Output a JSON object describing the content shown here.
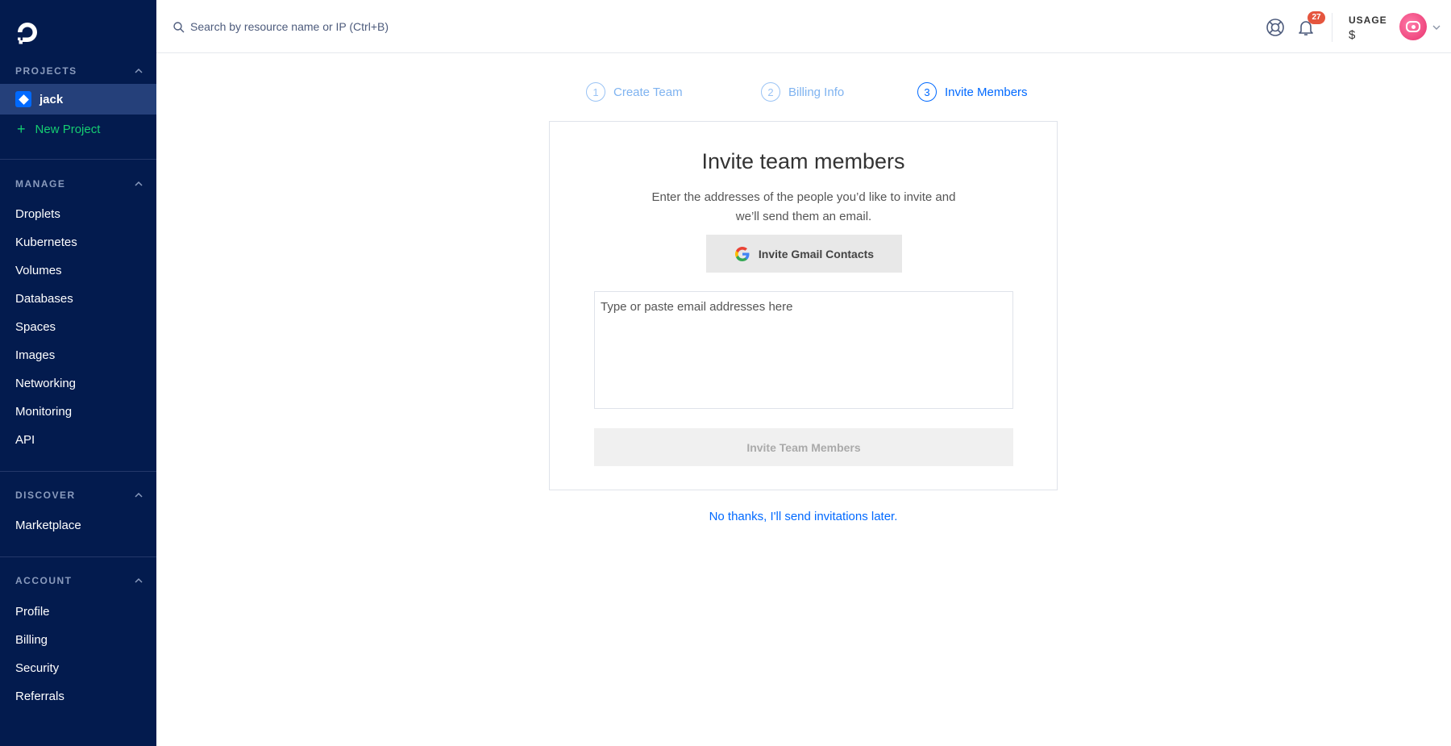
{
  "sidebar": {
    "projects_heading": "PROJECTS",
    "project": {
      "name": "jack"
    },
    "new_project": "New Project",
    "manage_heading": "MANAGE",
    "manage_items": [
      "Droplets",
      "Kubernetes",
      "Volumes",
      "Databases",
      "Spaces",
      "Images",
      "Networking",
      "Monitoring",
      "API"
    ],
    "discover_heading": "DISCOVER",
    "discover_items": [
      "Marketplace"
    ],
    "account_heading": "ACCOUNT",
    "account_items": [
      "Profile",
      "Billing",
      "Security",
      "Referrals"
    ]
  },
  "topbar": {
    "search_placeholder": "Search by resource name or IP (Ctrl+B)",
    "notifications_count": "27",
    "usage_label": "USAGE",
    "usage_value": "$"
  },
  "stepper": {
    "steps": [
      {
        "number": "1",
        "label": "Create Team"
      },
      {
        "number": "2",
        "label": "Billing Info"
      },
      {
        "number": "3",
        "label": "Invite Members"
      }
    ]
  },
  "invite": {
    "title": "Invite team members",
    "description": "Enter the addresses of the people you’d like to invite and we’ll send them an email.",
    "gmail_button": "Invite Gmail Contacts",
    "email_placeholder": "Type or paste email addresses here",
    "submit_button": "Invite Team Members",
    "skip_link": "No thanks, I'll send invitations later."
  },
  "colors": {
    "sidebar_bg": "#031b4e",
    "accent": "#0069ff",
    "new_project": "#15cd72",
    "badge": "#e5553e"
  }
}
